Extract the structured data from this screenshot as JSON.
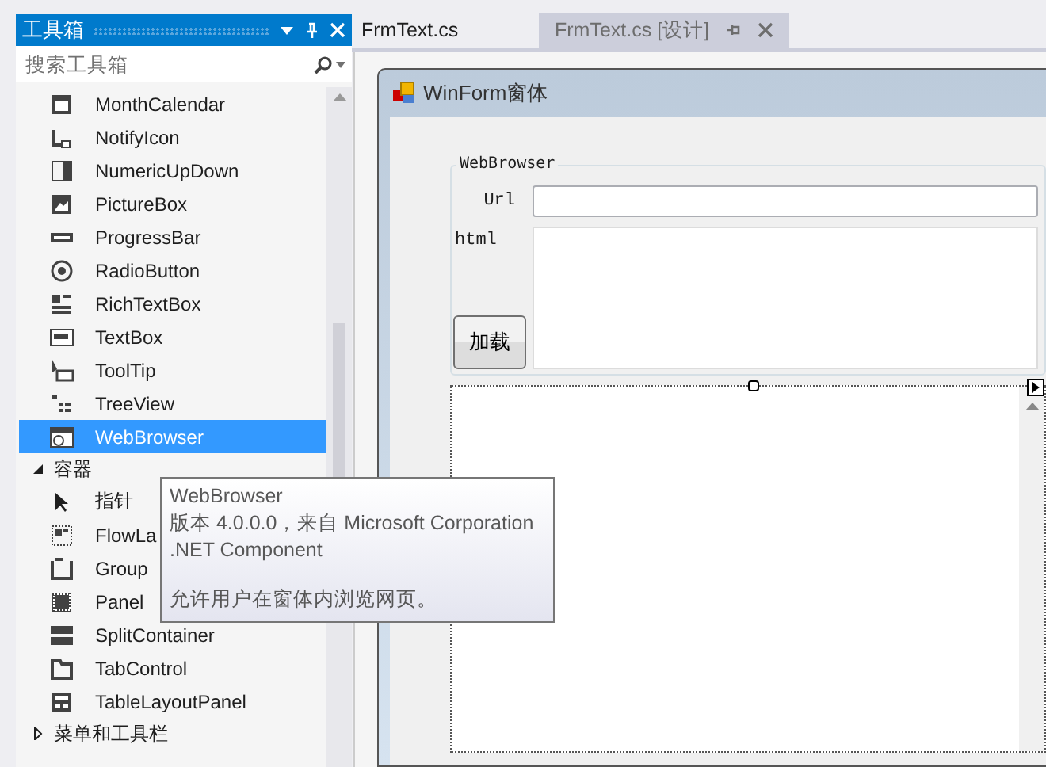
{
  "toolbox": {
    "title": "工具箱",
    "search": {
      "placeholder": "搜索工具箱"
    },
    "items": [
      {
        "label": "MonthCalendar",
        "selected": false
      },
      {
        "label": "NotifyIcon",
        "selected": false
      },
      {
        "label": "NumericUpDown",
        "selected": false
      },
      {
        "label": "PictureBox",
        "selected": false
      },
      {
        "label": "ProgressBar",
        "selected": false
      },
      {
        "label": "RadioButton",
        "selected": false
      },
      {
        "label": "RichTextBox",
        "selected": false
      },
      {
        "label": "TextBox",
        "selected": false
      },
      {
        "label": "ToolTip",
        "selected": false
      },
      {
        "label": "TreeView",
        "selected": false
      },
      {
        "label": "WebBrowser",
        "selected": true
      }
    ],
    "groups": [
      {
        "label": "容器",
        "expanded": true,
        "children": [
          {
            "label": "指针",
            "selected": false
          },
          {
            "label": "FlowLa",
            "selected": false
          },
          {
            "label": "Group",
            "selected": false
          },
          {
            "label": "Panel",
            "selected": false
          },
          {
            "label": "SplitContainer",
            "selected": false
          },
          {
            "label": "TabControl",
            "selected": false
          },
          {
            "label": "TableLayoutPanel",
            "selected": false
          }
        ]
      },
      {
        "label": "菜单和工具栏",
        "expanded": false
      }
    ]
  },
  "tooltip": {
    "title": "WebBrowser",
    "lines": [
      "版本 4.0.0.0，来自 Microsoft Corporation",
      ".NET Component"
    ],
    "description": "允许用户在窗体内浏览网页。"
  },
  "tabs": [
    {
      "label": "FrmText.cs",
      "selected": false,
      "pinned": false
    },
    {
      "label": "FrmText.cs [设计]",
      "selected": true,
      "pinned": true
    }
  ],
  "form": {
    "title": "WinForm窗体",
    "group": {
      "label": "WebBrowser",
      "url_label": "Url",
      "html_label": "html",
      "button": "加载"
    }
  }
}
